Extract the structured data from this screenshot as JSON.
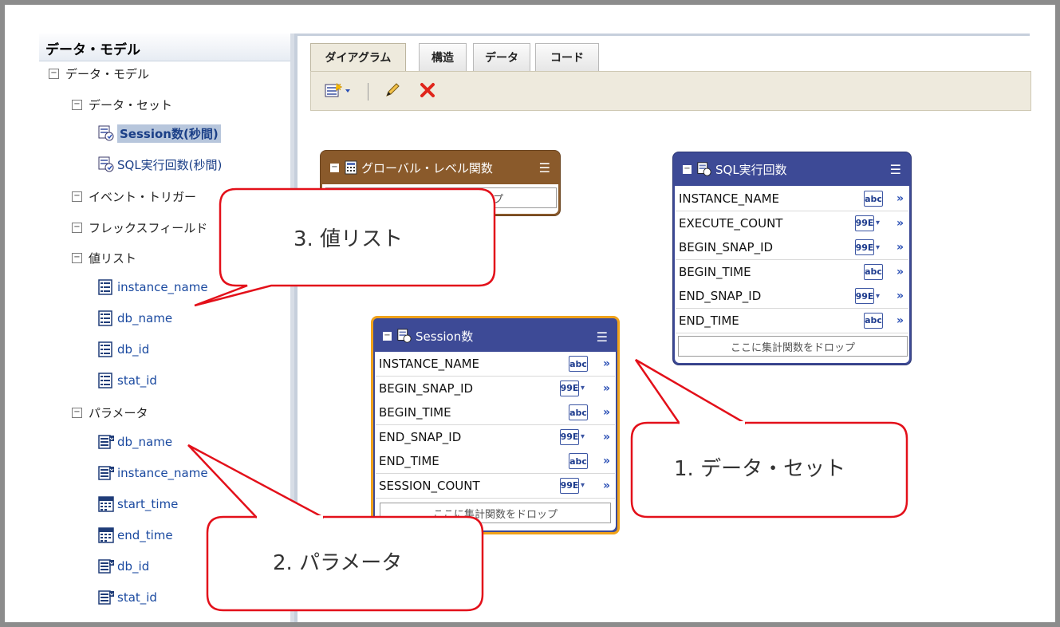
{
  "sidebar": {
    "title": "データ・モデル",
    "root": "データ・モデル",
    "datasets_group": "データ・セット",
    "datasets": [
      "Session数(秒間)",
      "SQL実行回数(秒間)"
    ],
    "event_triggers": "イベント・トリガー",
    "flexfields": "フレックスフィールド",
    "lov_group": "値リスト",
    "lovs": [
      "instance_name",
      "db_name",
      "db_id",
      "stat_id"
    ],
    "params_group": "パラメータ",
    "params": [
      "db_name",
      "instance_name",
      "start_time",
      "end_time",
      "db_id",
      "stat_id"
    ]
  },
  "tabs": [
    "ダイアグラム",
    "構造",
    "データ",
    "コード"
  ],
  "active_tab": "ダイアグラム",
  "global_box": {
    "title": "グローバル・レベル関数",
    "drop_text": "ここに集計関数をドロップ"
  },
  "sql_box": {
    "title": "SQL実行回数",
    "fields": [
      {
        "name": "INSTANCE_NAME",
        "type": "abc"
      },
      {
        "name": "EXECUTE_COUNT",
        "type": "99E"
      },
      {
        "name": "BEGIN_SNAP_ID",
        "type": "99E"
      },
      {
        "name": "BEGIN_TIME",
        "type": "abc"
      },
      {
        "name": "END_SNAP_ID",
        "type": "99E"
      },
      {
        "name": "END_TIME",
        "type": "abc"
      }
    ],
    "drop_text": "ここに集計関数をドロップ"
  },
  "session_box": {
    "title": "Session数",
    "fields": [
      {
        "name": "INSTANCE_NAME",
        "type": "abc"
      },
      {
        "name": "BEGIN_SNAP_ID",
        "type": "99E"
      },
      {
        "name": "BEGIN_TIME",
        "type": "abc"
      },
      {
        "name": "END_SNAP_ID",
        "type": "99E"
      },
      {
        "name": "END_TIME",
        "type": "abc"
      },
      {
        "name": "SESSION_COUNT",
        "type": "99E"
      }
    ],
    "drop_text": "ここに集計関数をドロップ"
  },
  "callouts": {
    "lov": "3. 値リスト",
    "dataset": "1. データ・セット",
    "params": "2. パラメータ"
  },
  "colors": {
    "callout_border": "#e3101a",
    "box_blue_head": "#3d4a96",
    "box_brown_head": "#8a5a2b",
    "selected_box_border": "#f0a21a"
  }
}
